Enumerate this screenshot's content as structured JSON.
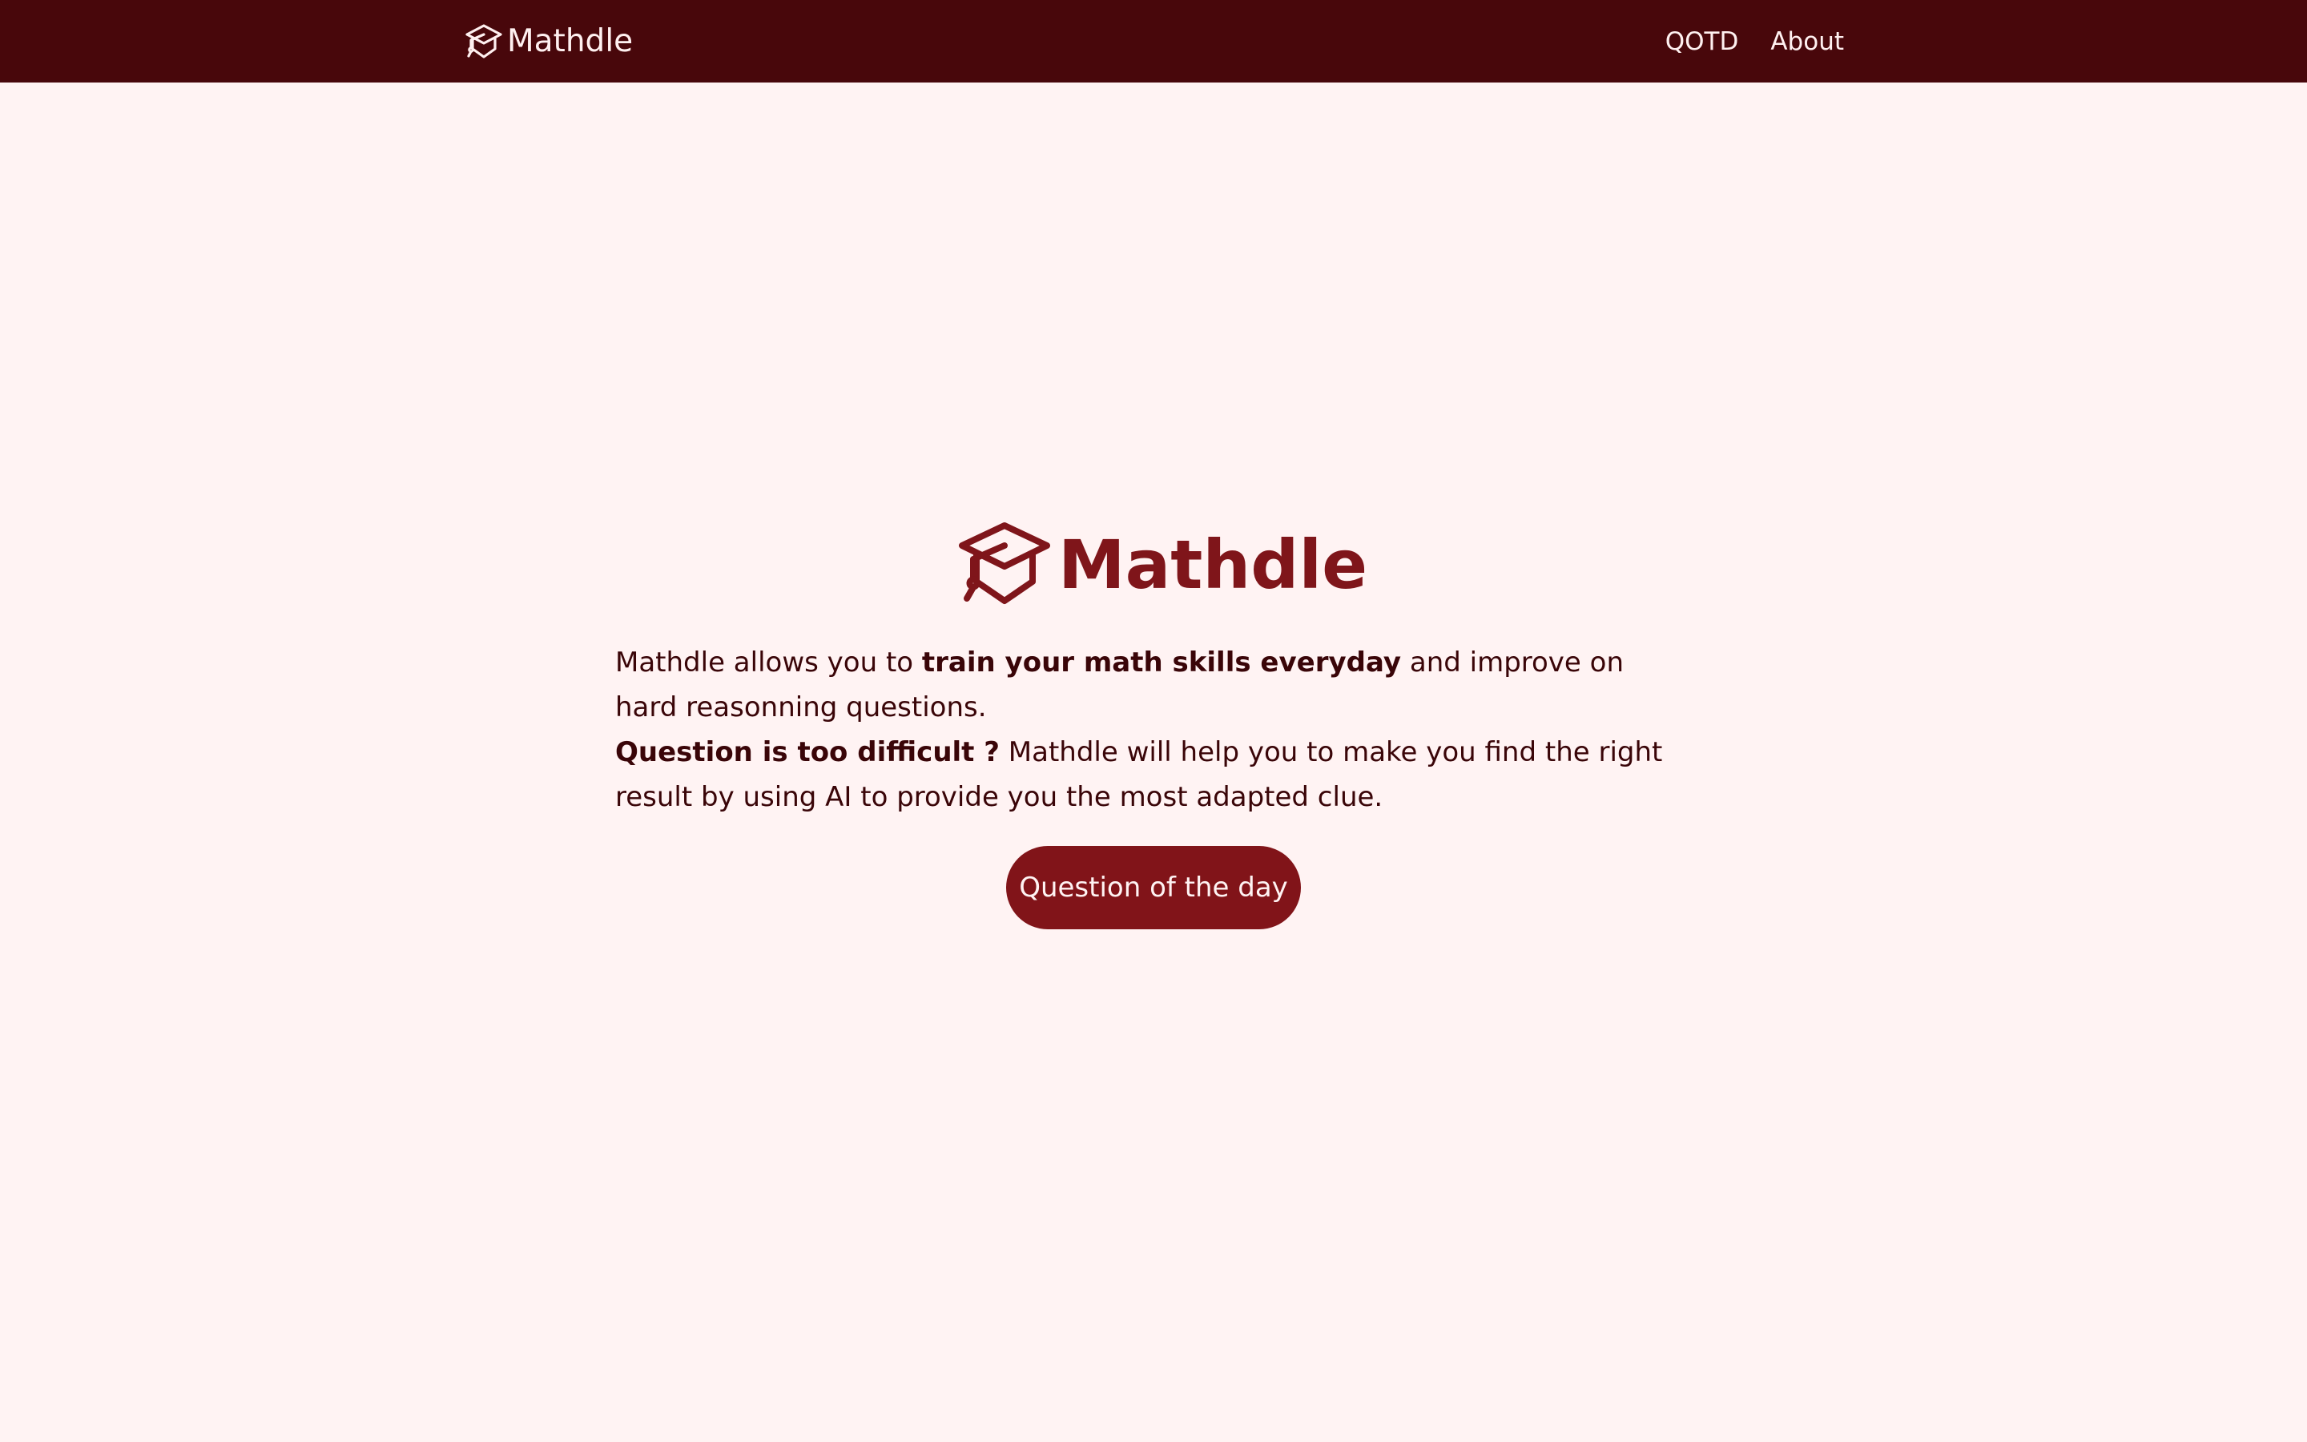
{
  "navbar": {
    "brand_icon": "graduation-cap-icon",
    "brand_label": "Mathdle",
    "links": [
      {
        "label": "QOTD"
      },
      {
        "label": "About"
      }
    ]
  },
  "hero": {
    "icon": "graduation-cap-icon",
    "title": "Mathdle",
    "intro_line1": {
      "prefix": "Mathdle allows you to ",
      "emphasis": "train your math skills everyday",
      "suffix": " and improve on hard reasonning questions."
    },
    "intro_line2": {
      "emphasis": "Question is too difficult ?",
      "suffix": " Mathdle will help you to make you find the right result by using AI to provide you the most adapted clue."
    },
    "button_label": "Question of the day"
  },
  "colors": {
    "navbar_background": "#48070b",
    "page_background": "#fff3f3",
    "accent": "#811419",
    "text": "#3a0508"
  }
}
